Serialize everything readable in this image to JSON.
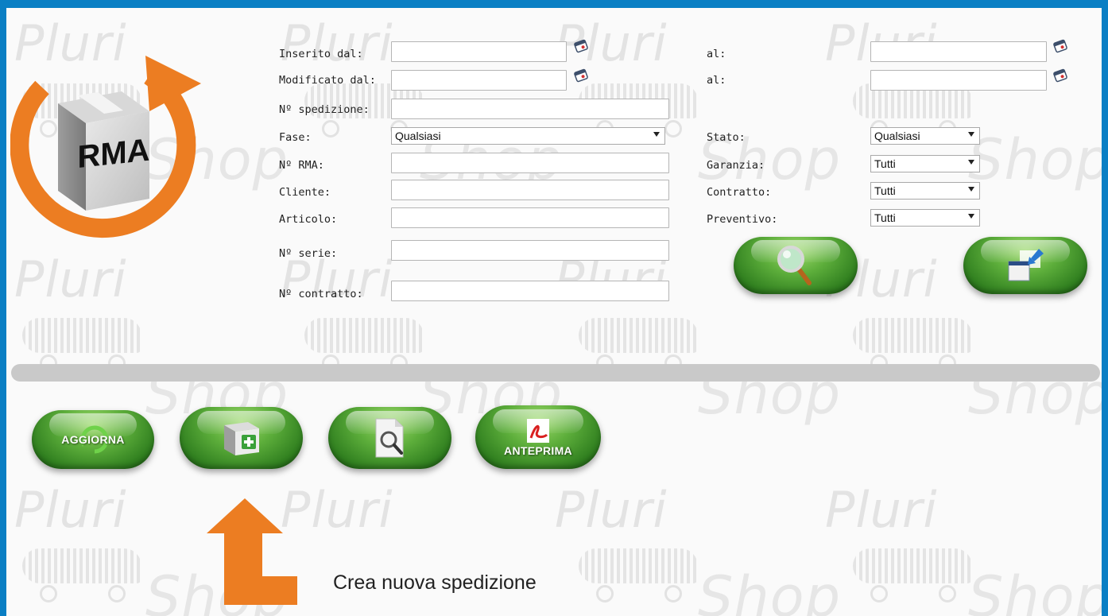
{
  "watermark": {
    "pluri": "Pluri",
    "shop": "Shop"
  },
  "logo": {
    "text": "RMA"
  },
  "filters": {
    "inserted_from_label": "Inserito dal:",
    "inserted_to_label": "al:",
    "modified_from_label": "Modificato dal:",
    "modified_to_label": "al:",
    "shipment_no_label": "Nº spedizione:",
    "phase_label": "Fase:",
    "phase_value": "Qualsiasi",
    "status_label": "Stato:",
    "status_value": "Qualsiasi",
    "rma_no_label": "Nº RMA:",
    "warranty_label": "Garanzia:",
    "warranty_value": "Tutti",
    "customer_label": "Cliente:",
    "contract_label": "Contratto:",
    "contract_value": "Tutti",
    "article_label": "Articolo:",
    "quote_label": "Preventivo:",
    "quote_value": "Tutti",
    "serial_no_label": "Nº serie:",
    "contract_no_label": "Nº contratto:"
  },
  "actions": {
    "refresh_label": "AGGIORNA",
    "preview_label": "ANTEPRIMA"
  },
  "hint": {
    "text": "Crea nuova spedizione"
  },
  "colors": {
    "frame": "#0a7fc4",
    "button_green": "#3f9a2a",
    "accent_orange": "#ec7d22"
  }
}
